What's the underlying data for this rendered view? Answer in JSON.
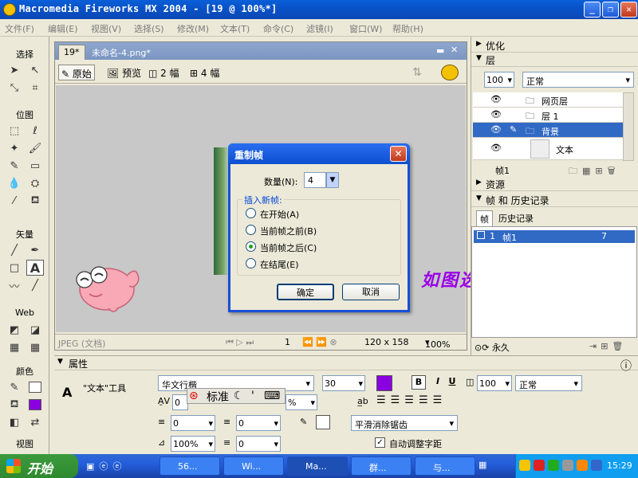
{
  "window": {
    "title": "Macromedia Fireworks MX 2004 - [19 @ 100%*]",
    "min": "_",
    "max": "❐",
    "close": "✕"
  },
  "menu": [
    "文件(F)",
    "编辑(E)",
    "视图(V)",
    "选择(S)",
    "修改(M)",
    "文本(T)",
    "命令(C)",
    "滤镜(I)",
    "窗口(W)",
    "帮助(H)"
  ],
  "toolbox": {
    "select": "选择",
    "bitmap": "位图",
    "vector": "矢量",
    "web": "Web",
    "colors": "颜色",
    "view": "视图"
  },
  "document": {
    "tabs": [
      "19*",
      "未命名-4.png*"
    ],
    "views": [
      "原始",
      "预览",
      "2 幅",
      "4 幅"
    ],
    "status": {
      "format": "JPEG (文档)",
      "frame": "1",
      "size": "120 x 158",
      "zoom": "100%"
    }
  },
  "canvas_annotation": "如图选择好",
  "panels": {
    "optimize": "优化",
    "layers": {
      "title": "层",
      "opacity": "100",
      "blend": "正常",
      "items": [
        {
          "name": "网页层"
        },
        {
          "name": "层 1"
        },
        {
          "name": "背景"
        },
        {
          "name": "文本"
        }
      ],
      "frame_label": "帧1"
    },
    "assets": "资源",
    "frames_history": {
      "title": "帧 和 历史记录",
      "tabs": [
        "帧",
        "历史记录"
      ],
      "row": {
        "num": "1",
        "name": "帧1",
        "delay": "7"
      },
      "footer": "永久"
    }
  },
  "properties": {
    "title": "属性",
    "tool": "\"文本\"工具",
    "font": "华文行楷",
    "size": "30",
    "ime": [
      "标准"
    ],
    "bold": "B",
    "italic": "I",
    "underline": "U",
    "opacity": "100",
    "blend": "正常",
    "kern": "0",
    "lead": "%",
    "indent": "0",
    "space_before": "0",
    "space_after": "0",
    "scale": "100%",
    "baseline": "0",
    "antialias": "平滑消除锯齿",
    "autokern": "自动调整字距",
    "colors": {
      "text": "#8a00e0",
      "stroke": "#ffffff",
      "fill": "#8a00e0"
    }
  },
  "dialog": {
    "title": "重制帧",
    "count_label": "数量(N):",
    "count_value": "4",
    "group_label": "插入新帧:",
    "options": [
      "在开始(A)",
      "当前帧之前(B)",
      "当前帧之后(C)",
      "在结尾(E)"
    ],
    "selected": 2,
    "ok": "确定",
    "cancel": "取消"
  },
  "taskbar": {
    "start": "开始",
    "tasks": [
      "56...",
      "Wi...",
      "Ma...",
      "群...",
      "与..."
    ],
    "clock": "15:29"
  }
}
